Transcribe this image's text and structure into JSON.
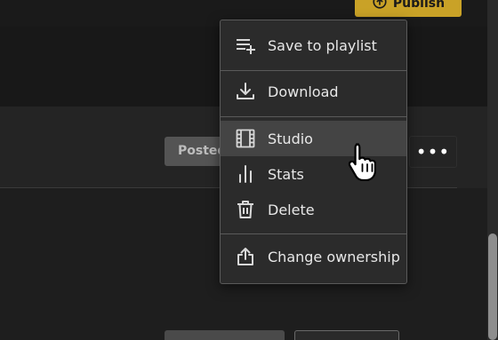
{
  "header": {
    "publish_label": "Publish",
    "publish_icon": "upload-cloud-icon",
    "accent_color": "#c9a227"
  },
  "track": {
    "posted_label": "Posted",
    "more_label": "•••"
  },
  "menu": {
    "items": [
      {
        "label": "Save to playlist",
        "icon": "playlist-add-icon"
      },
      {
        "label": "Download",
        "icon": "download-icon"
      },
      {
        "label": "Studio",
        "icon": "film-icon",
        "hovered": true
      },
      {
        "label": "Stats",
        "icon": "bar-chart-icon"
      },
      {
        "label": "Delete",
        "icon": "trash-icon"
      },
      {
        "label": "Change ownership",
        "icon": "share-upload-icon"
      }
    ]
  },
  "cursor": {
    "icon": "hand-pointer-icon"
  }
}
